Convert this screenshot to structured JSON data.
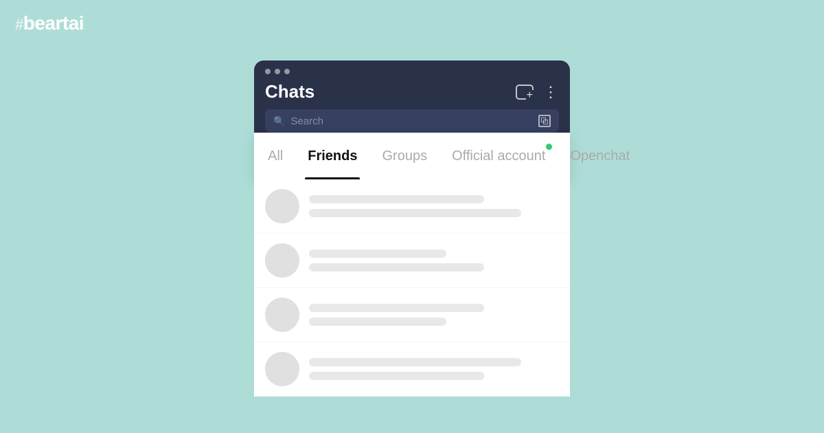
{
  "logo": {
    "hash": "#",
    "text": "beartai"
  },
  "header": {
    "dots": [
      "dot1",
      "dot2",
      "dot3"
    ],
    "title": "Chats",
    "search_placeholder": "Search",
    "icons": {
      "new_chat": "chat-add",
      "more": "more-vertical"
    }
  },
  "tabs": [
    {
      "id": "all",
      "label": "All",
      "active": false,
      "badge": false
    },
    {
      "id": "friends",
      "label": "Friends",
      "active": true,
      "badge": false
    },
    {
      "id": "groups",
      "label": "Groups",
      "active": false,
      "badge": false
    },
    {
      "id": "official-account",
      "label": "Official account",
      "active": false,
      "badge": true
    },
    {
      "id": "openchat",
      "label": "Openchat",
      "active": false,
      "badge": false
    }
  ],
  "chat_rows": [
    {
      "id": 1
    },
    {
      "id": 2
    },
    {
      "id": 3
    },
    {
      "id": 4
    }
  ],
  "colors": {
    "background": "#aeddd7",
    "header_bg": "#2a3249",
    "white": "#ffffff",
    "badge_green": "#2ecc71",
    "active_tab_color": "#111111",
    "inactive_tab_color": "#aaaaaa"
  }
}
